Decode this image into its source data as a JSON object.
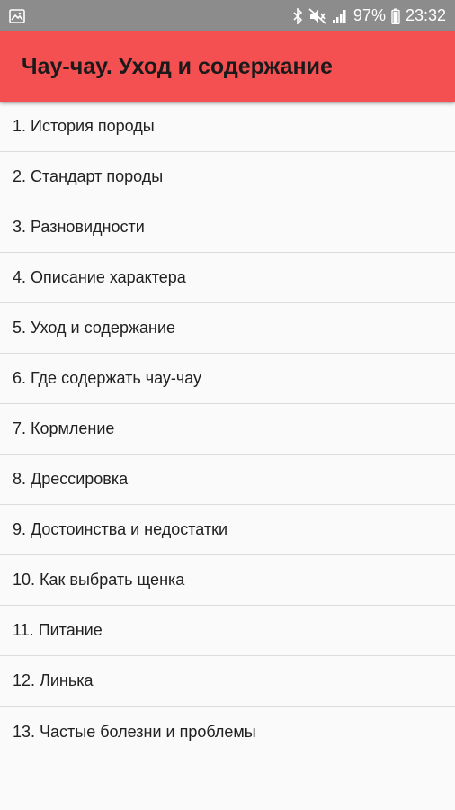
{
  "status_bar": {
    "battery_percent": "97%",
    "time": "23:32",
    "icons": [
      "gallery-icon",
      "bluetooth-icon",
      "mute-icon",
      "signal-icon",
      "battery-icon"
    ]
  },
  "app_bar": {
    "title": "Чау-чау. Уход и содержание",
    "background_color": "#f45052"
  },
  "menu": {
    "items": [
      {
        "label": "1. История породы"
      },
      {
        "label": "2. Стандарт породы"
      },
      {
        "label": "3. Разновидности"
      },
      {
        "label": "4. Описание характера"
      },
      {
        "label": "5. Уход и содержание"
      },
      {
        "label": "6. Где содержать чау-чау"
      },
      {
        "label": "7. Кормление"
      },
      {
        "label": "8. Дрессировка"
      },
      {
        "label": "9. Достоинства и недостатки"
      },
      {
        "label": "10. Как выбрать щенка"
      },
      {
        "label": "11. Питание"
      },
      {
        "label": "12. Линька"
      },
      {
        "label": "13. Частые болезни и проблемы"
      }
    ]
  }
}
